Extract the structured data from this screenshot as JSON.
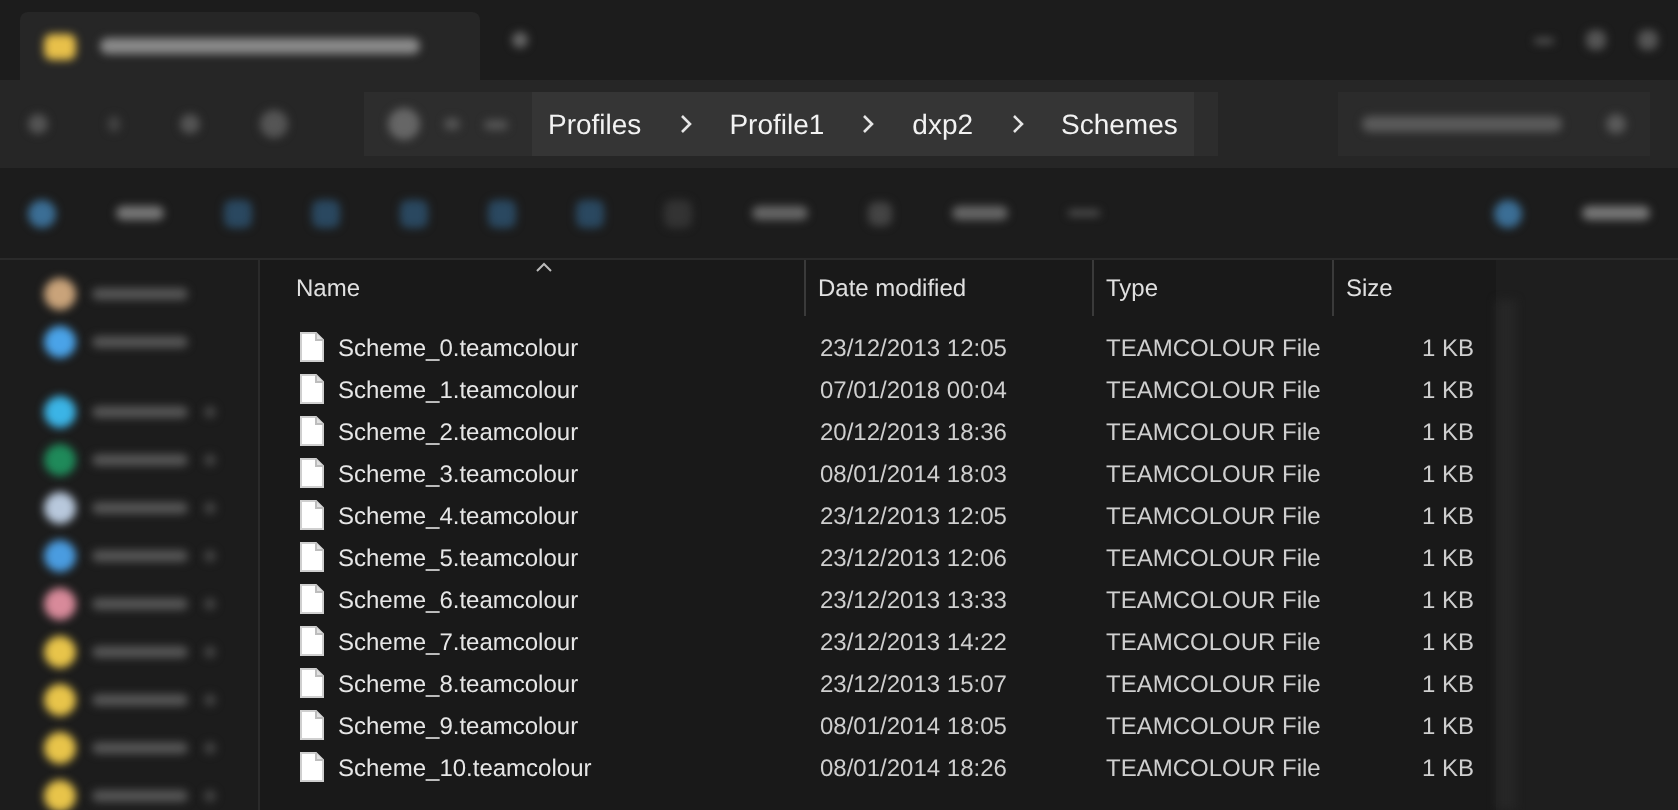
{
  "breadcrumb": [
    {
      "label": "Profiles"
    },
    {
      "label": "Profile1"
    },
    {
      "label": "dxp2"
    },
    {
      "label": "Schemes"
    }
  ],
  "table": {
    "columns": [
      {
        "label": "Name",
        "sorted": true
      },
      {
        "label": "Date modified",
        "sorted": false
      },
      {
        "label": "Type",
        "sorted": false
      },
      {
        "label": "Size",
        "sorted": false
      }
    ],
    "rows": [
      {
        "name": "Scheme_0.teamcolour",
        "date": "23/12/2013 12:05",
        "type": "TEAMCOLOUR File",
        "size": "1 KB"
      },
      {
        "name": "Scheme_1.teamcolour",
        "date": "07/01/2018 00:04",
        "type": "TEAMCOLOUR File",
        "size": "1 KB"
      },
      {
        "name": "Scheme_2.teamcolour",
        "date": "20/12/2013 18:36",
        "type": "TEAMCOLOUR File",
        "size": "1 KB"
      },
      {
        "name": "Scheme_3.teamcolour",
        "date": "08/01/2014 18:03",
        "type": "TEAMCOLOUR File",
        "size": "1 KB"
      },
      {
        "name": "Scheme_4.teamcolour",
        "date": "23/12/2013 12:05",
        "type": "TEAMCOLOUR File",
        "size": "1 KB"
      },
      {
        "name": "Scheme_5.teamcolour",
        "date": "23/12/2013 12:06",
        "type": "TEAMCOLOUR File",
        "size": "1 KB"
      },
      {
        "name": "Scheme_6.teamcolour",
        "date": "23/12/2013 13:33",
        "type": "TEAMCOLOUR File",
        "size": "1 KB"
      },
      {
        "name": "Scheme_7.teamcolour",
        "date": "23/12/2013 14:22",
        "type": "TEAMCOLOUR File",
        "size": "1 KB"
      },
      {
        "name": "Scheme_8.teamcolour",
        "date": "23/12/2013 15:07",
        "type": "TEAMCOLOUR File",
        "size": "1 KB"
      },
      {
        "name": "Scheme_9.teamcolour",
        "date": "08/01/2014 18:05",
        "type": "TEAMCOLOUR File",
        "size": "1 KB"
      },
      {
        "name": "Scheme_10.teamcolour",
        "date": "08/01/2014 18:26",
        "type": "TEAMCOLOUR File",
        "size": "1 KB"
      }
    ]
  }
}
